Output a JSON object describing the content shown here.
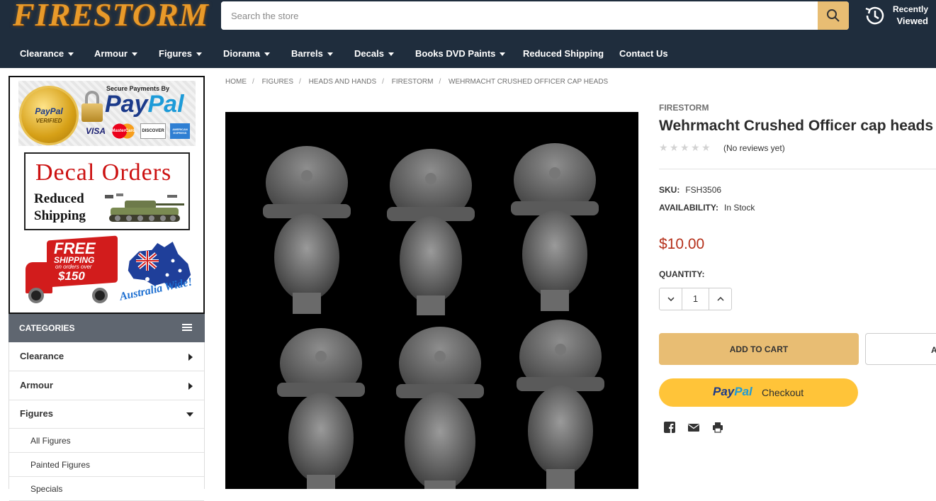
{
  "header": {
    "logo_text": "FIRESTORM",
    "search_placeholder": "Search the store",
    "recently_viewed_line1": "Recently",
    "recently_viewed_line2": "Viewed"
  },
  "nav": {
    "items": [
      {
        "label": "Clearance",
        "has_dropdown": true
      },
      {
        "label": "Armour",
        "has_dropdown": true
      },
      {
        "label": "Figures",
        "has_dropdown": true
      },
      {
        "label": "Diorama",
        "has_dropdown": true
      },
      {
        "label": "Barrels",
        "has_dropdown": true
      },
      {
        "label": "Decals",
        "has_dropdown": true
      },
      {
        "label": "Books DVD Paints",
        "has_dropdown": true
      },
      {
        "label": "Reduced Shipping",
        "has_dropdown": false
      },
      {
        "label": "Contact Us",
        "has_dropdown": false
      }
    ]
  },
  "promos": {
    "paypal": {
      "seal_line1": "PayPal",
      "seal_line2": "VERIFIED",
      "secure_text": "Secure Payments By",
      "brand_pay": "Pay",
      "brand_pal": "Pal",
      "cards": [
        "VISA",
        "MasterCard",
        "DISCOVER",
        "AMERICAN EXPRESS"
      ]
    },
    "decal": {
      "title": "Decal Orders",
      "line1": "Reduced",
      "line2": "Shipping"
    },
    "shipping": {
      "free": "FREE",
      "shipping": "SHIPPING",
      "orders_over": "on orders over",
      "amount": "$150",
      "aus_text": "Australia Wide!"
    }
  },
  "categories": {
    "header": "CATEGORIES",
    "items": [
      {
        "label": "Clearance",
        "expanded": false
      },
      {
        "label": "Armour",
        "expanded": false
      },
      {
        "label": "Figures",
        "expanded": true
      }
    ],
    "subitems": [
      "All Figures",
      "Painted Figures",
      "Specials"
    ]
  },
  "breadcrumb": [
    "Home",
    "Figures",
    "Heads and Hands",
    "Firestorm",
    "Wehrmacht Crushed Officer cap heads"
  ],
  "product": {
    "brand": "FIRESTORM",
    "title": "Wehrmacht Crushed Officer cap heads",
    "rating_stars": 0,
    "reviews_text": "(No reviews yet)",
    "sku_label": "SKU:",
    "sku": "FSH3506",
    "availability_label": "AVAILABILITY:",
    "availability": "In Stock",
    "price": "$10.00",
    "quantity_label": "QUANTITY:",
    "quantity": "1",
    "add_to_cart": "ADD TO CART",
    "add_to_wishlist_fragment": "A",
    "paypal_pay": "Pay",
    "paypal_pal": "Pal",
    "paypal_checkout": "Checkout"
  },
  "colors": {
    "header_bg": "#1f2d3d",
    "accent": "#e8bd73",
    "price": "#b5301a",
    "paypal_yellow": "#ffc439"
  },
  "icons": [
    "search-icon",
    "history-icon",
    "caret-down-icon",
    "menu-icon",
    "chevron-right-icon",
    "chevron-down-icon",
    "minus-icon",
    "plus-icon",
    "facebook-icon",
    "email-icon",
    "print-icon"
  ]
}
